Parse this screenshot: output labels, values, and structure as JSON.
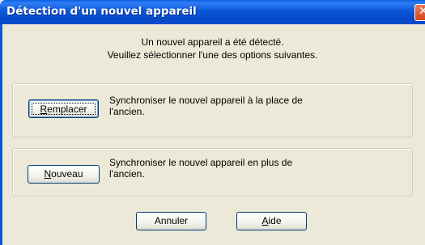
{
  "window": {
    "title": "Détection d'un nouvel appareil",
    "close_glyph": "✕"
  },
  "intro": {
    "line1": "Un nouvel appareil a été détecté.",
    "line2": "Veuillez sélectionner l'une des options suivantes."
  },
  "options": [
    {
      "button_mnemonic": "R",
      "button_rest": "emplacer",
      "desc_line1": "Synchroniser le nouvel appareil à la place de",
      "desc_line2": "l'ancien."
    },
    {
      "button_mnemonic": "N",
      "button_rest": "ouveau",
      "desc_line1": "Synchroniser le nouvel appareil en plus de",
      "desc_line2": "l'ancien."
    }
  ],
  "footer": {
    "cancel_label": "Annuler",
    "help_mnemonic": "A",
    "help_rest": "ide"
  },
  "colors": {
    "titlebar": "#0b58d8",
    "dialog_bg": "#ece9d8",
    "button_border": "#003c74"
  }
}
